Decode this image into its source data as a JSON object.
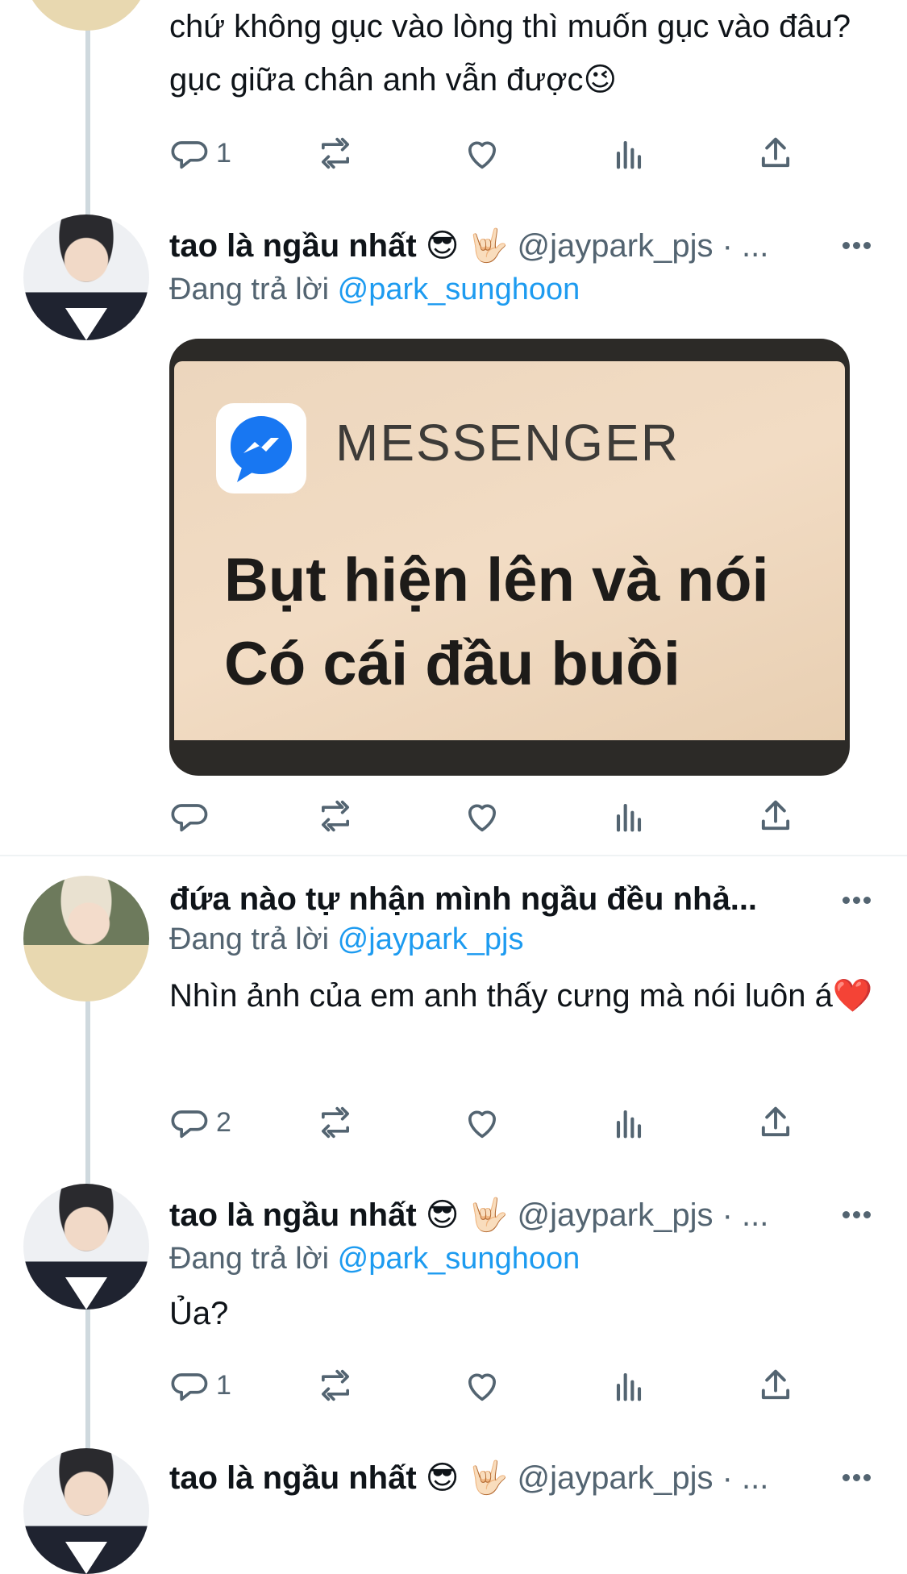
{
  "tweets": [
    {
      "text": "chứ không gục vào lòng thì muốn gục vào đâu? gục giữa chân anh vẫn được😉",
      "reply_count": "1"
    },
    {
      "name": "tao là ngầu nhất 😎 🤟🏻",
      "handle": "@jaypark_pjs · ...",
      "replying_label": "Đang trả lời",
      "replying_to": "@park_sunghoon",
      "media": {
        "app_name": "MESSENGER",
        "line1": "Bụt hiện lên và nói",
        "line2": "Có cái đầu buồi"
      }
    },
    {
      "name": "đứa nào tự nhận mình ngầu đều nhả...",
      "replying_label": "Đang trả lời",
      "replying_to": "@jaypark_pjs",
      "text": "Nhìn ảnh của em anh thấy cưng mà nói luôn á❤️",
      "reply_count": "2"
    },
    {
      "name": "tao là ngầu nhất 😎 🤟🏻",
      "handle": "@jaypark_pjs · ...",
      "replying_label": "Đang trả lời",
      "replying_to": "@park_sunghoon",
      "text": "Ủa?",
      "reply_count": "1"
    },
    {
      "name": "tao là ngầu nhất 😎 🤟🏻",
      "handle": "@jaypark_pjs · ..."
    }
  ],
  "colors": {
    "accent": "#1d9bf0",
    "secondary_text": "#536471",
    "thread_line": "#cfd9de"
  }
}
